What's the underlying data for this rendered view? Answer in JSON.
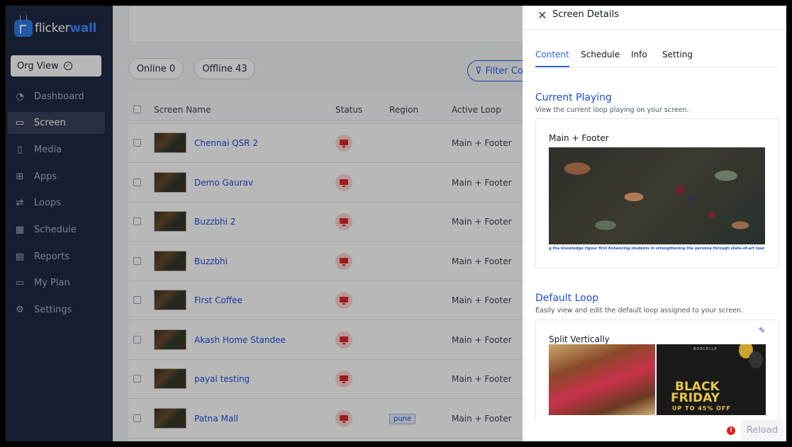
{
  "brand": {
    "name_a": "flicker",
    "name_b": "wall"
  },
  "org_button": "Org View",
  "sidebar": {
    "items": [
      {
        "label": "Dashboard",
        "icon": "dashboard-icon"
      },
      {
        "label": "Screen",
        "icon": "monitor-icon",
        "active": true
      },
      {
        "label": "Media",
        "icon": "media-icon"
      },
      {
        "label": "Apps",
        "icon": "apps-icon"
      },
      {
        "label": "Loops",
        "icon": "loops-icon"
      },
      {
        "label": "Schedule",
        "icon": "calendar-icon"
      },
      {
        "label": "Reports",
        "icon": "reports-icon"
      },
      {
        "label": "My Plan",
        "icon": "card-icon"
      },
      {
        "label": "Settings",
        "icon": "gear-icon"
      }
    ]
  },
  "filters": {
    "online": "Online 0",
    "offline": "Offline 43",
    "filter": "Filter Co"
  },
  "table": {
    "headers": {
      "name": "Screen Name",
      "status": "Status",
      "region": "Region",
      "loop": "Active Loop"
    },
    "rows": [
      {
        "name": "Chennai QSR 2",
        "region": "",
        "loop": "Main + Footer"
      },
      {
        "name": "Demo Gaurav",
        "region": "",
        "loop": "Main + Footer"
      },
      {
        "name": "Buzzbhi 2",
        "region": "",
        "loop": "Main + Footer"
      },
      {
        "name": "Buzzbhi",
        "region": "",
        "loop": "Main + Footer"
      },
      {
        "name": "First Coffee",
        "region": "",
        "loop": "Main + Footer"
      },
      {
        "name": "Akash Home Standee",
        "region": "",
        "loop": "Main + Footer"
      },
      {
        "name": "payal testing",
        "region": "",
        "loop": "Main + Footer"
      },
      {
        "name": "Patna Mall",
        "region": "pune",
        "loop": "Main + Footer"
      }
    ]
  },
  "panel": {
    "title": "Screen Details",
    "tabs": [
      "Content",
      "Schedule",
      "Info",
      "Setting"
    ],
    "current": {
      "title": "Current Playing",
      "subtitle": "View the current loop playing on your screen.",
      "loop_name": "Main + Footer",
      "ticker": "g the knowledge rigour first Enhancing students in strengthening the persona through state-of-art teaching pedagogy supporte"
    },
    "default": {
      "title": "Default Loop",
      "subtitle": "Easily view and edit the default loop assigned to your screen.",
      "loop_name": "Split Vertically",
      "promo_brand": "BORCELLE",
      "promo_line1": "BLACK",
      "promo_line2": "FRIDAY",
      "promo_offer": "UP TO 45% OFF"
    },
    "reload": "Reload"
  }
}
